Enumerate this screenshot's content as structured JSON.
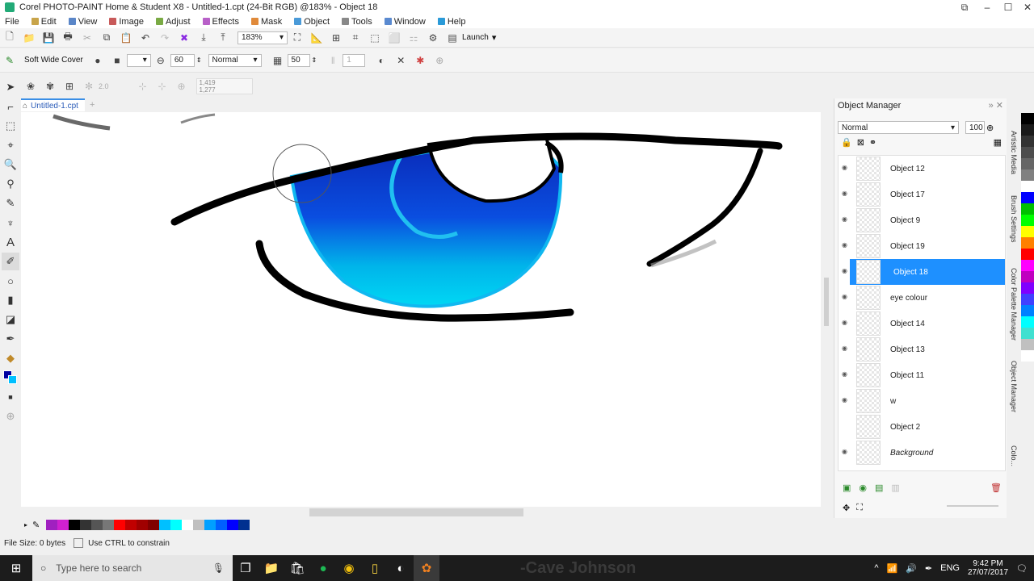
{
  "window": {
    "title": "Corel PHOTO-PAINT Home & Student X8 - Untitled-1.cpt (24-Bit RGB) @183% - Object 18"
  },
  "menu": [
    "File",
    "Edit",
    "View",
    "Image",
    "Adjust",
    "Effects",
    "Mask",
    "Object",
    "Tools",
    "Window",
    "Help"
  ],
  "toolbar1": {
    "zoom": "183%",
    "launch_label": "Launch"
  },
  "toolbar2": {
    "brush_name": "Soft Wide Cover",
    "nib_size": "60",
    "merge_mode": "Normal",
    "transparency": "50",
    "stroke_count": "1"
  },
  "toolbar3": {
    "value_a": "2.0",
    "coord_x": "1,419",
    "coord_y": "1,277"
  },
  "document": {
    "tab_label": "Untitled-1.cpt"
  },
  "object_manager": {
    "title": "Object Manager",
    "merge_mode": "Normal",
    "opacity": "100",
    "layers": [
      {
        "name": "Object 12",
        "visible": true,
        "selected": false
      },
      {
        "name": "Object 17",
        "visible": true,
        "selected": false
      },
      {
        "name": "Object 9",
        "visible": true,
        "selected": false
      },
      {
        "name": "Object 19",
        "visible": true,
        "selected": false
      },
      {
        "name": "Object 18",
        "visible": true,
        "selected": true
      },
      {
        "name": "eye colour",
        "visible": true,
        "selected": false
      },
      {
        "name": "Object 14",
        "visible": true,
        "selected": false
      },
      {
        "name": "Object 13",
        "visible": true,
        "selected": false
      },
      {
        "name": "Object 11",
        "visible": true,
        "selected": false
      },
      {
        "name": "w",
        "visible": true,
        "selected": false
      },
      {
        "name": "Object 2",
        "visible": false,
        "selected": false
      },
      {
        "name": "Background",
        "visible": true,
        "selected": false
      }
    ]
  },
  "side_tabs": [
    "Artistic Media",
    "Brush Settings",
    "Color Palette Manager",
    "Object Manager",
    "Colo..."
  ],
  "palette_colors": [
    "#a020c0",
    "#d020d0",
    "#000000",
    "#333333",
    "#555555",
    "#777777",
    "#ff0000",
    "#c00000",
    "#a00000",
    "#800000",
    "#00c0ff",
    "#00ffff",
    "#ffffff",
    "#c0c0c0",
    "#00a0ff",
    "#0060ff",
    "#0000ff",
    "#003090"
  ],
  "side_colors": [
    "#000000",
    "#1a1a1a",
    "#333333",
    "#4d4d4d",
    "#666666",
    "#808080",
    "#ffffff",
    "#0000ff",
    "#00c000",
    "#00ff00",
    "#ffff00",
    "#ff8000",
    "#ff0000",
    "#ff00ff",
    "#c000c0",
    "#8000ff",
    "#4040ff",
    "#0080ff",
    "#00ffff",
    "#40e0d0",
    "#c0c0c0",
    "#ffffff"
  ],
  "status": {
    "file_size": "File Size: 0 bytes",
    "hint": "Use CTRL to constrain"
  },
  "taskbar": {
    "search_placeholder": "Type here to search",
    "lang": "ENG",
    "time": "9:42 PM",
    "date": "27/07/2017",
    "watermark": "-Cave Johnson"
  }
}
